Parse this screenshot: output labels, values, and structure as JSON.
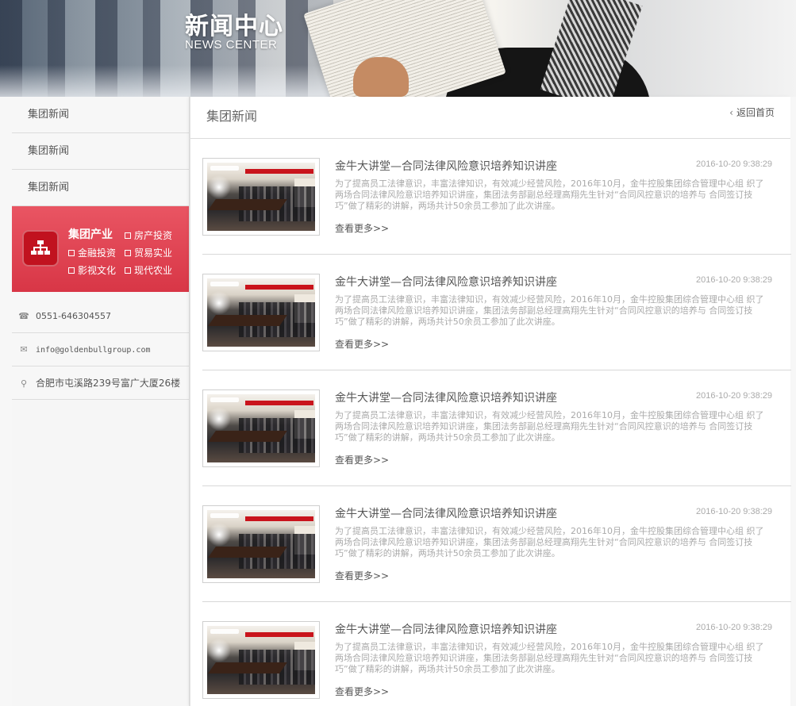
{
  "banner": {
    "title": "新闻中心",
    "subtitle": "NEWS CENTER"
  },
  "sidebar": {
    "items": [
      {
        "label": "集团新闻"
      },
      {
        "label": "集团新闻"
      },
      {
        "label": "集团新闻"
      }
    ],
    "industry": {
      "title": "集团产业",
      "links": [
        "房产投资",
        "金融投资",
        "贸易实业",
        "影视文化",
        "现代农业"
      ],
      "color": "#d83646"
    },
    "contact": {
      "phone": "0551-646304557",
      "email": "info@goldenbullgroup.com",
      "address": "合肥市屯溪路239号富广大厦26楼"
    }
  },
  "main": {
    "title": "集团新闻",
    "back_label": "返回首页",
    "news": [
      {
        "title": "金牛大讲堂—合同法律风险意识培养知识讲座",
        "date": "2016-10-20 9:38:29",
        "desc": "为了提高员工法律意识，丰富法律知识，有效减少经营风险，2016年10月，金牛控股集团综合管理中心组 织了两场合同法律风险意识培养知识讲座，集团法务部副总经理高翔先生针对“合同风控意识的培养与 合同签订技巧”做了精彩的讲解，两场共计50余员工参加了此次讲座。",
        "more": "查看更多>>"
      },
      {
        "title": "金牛大讲堂—合同法律风险意识培养知识讲座",
        "date": "2016-10-20 9:38:29",
        "desc": "为了提高员工法律意识，丰富法律知识，有效减少经营风险，2016年10月，金牛控股集团综合管理中心组 织了两场合同法律风险意识培养知识讲座，集团法务部副总经理高翔先生针对“合同风控意识的培养与 合同签订技巧”做了精彩的讲解，两场共计50余员工参加了此次讲座。",
        "more": "查看更多>>"
      },
      {
        "title": "金牛大讲堂—合同法律风险意识培养知识讲座",
        "date": "2016-10-20 9:38:29",
        "desc": "为了提高员工法律意识，丰富法律知识，有效减少经营风险，2016年10月，金牛控股集团综合管理中心组 织了两场合同法律风险意识培养知识讲座，集团法务部副总经理高翔先生针对“合同风控意识的培养与 合同签订技巧”做了精彩的讲解，两场共计50余员工参加了此次讲座。",
        "more": "查看更多>>"
      },
      {
        "title": "金牛大讲堂—合同法律风险意识培养知识讲座",
        "date": "2016-10-20 9:38:29",
        "desc": "为了提高员工法律意识，丰富法律知识，有效减少经营风险，2016年10月，金牛控股集团综合管理中心组 织了两场合同法律风险意识培养知识讲座，集团法务部副总经理高翔先生针对“合同风控意识的培养与 合同签订技巧”做了精彩的讲解，两场共计50余员工参加了此次讲座。",
        "more": "查看更多>>"
      },
      {
        "title": "金牛大讲堂—合同法律风险意识培养知识讲座",
        "date": "2016-10-20 9:38:29",
        "desc": "为了提高员工法律意识，丰富法律知识，有效减少经营风险，2016年10月，金牛控股集团综合管理中心组 织了两场合同法律风险意识培养知识讲座，集团法务部副总经理高翔先生针对“合同风控意识的培养与 合同签订技巧”做了精彩的讲解，两场共计50余员工参加了此次讲座。",
        "more": "查看更多>>"
      }
    ]
  }
}
